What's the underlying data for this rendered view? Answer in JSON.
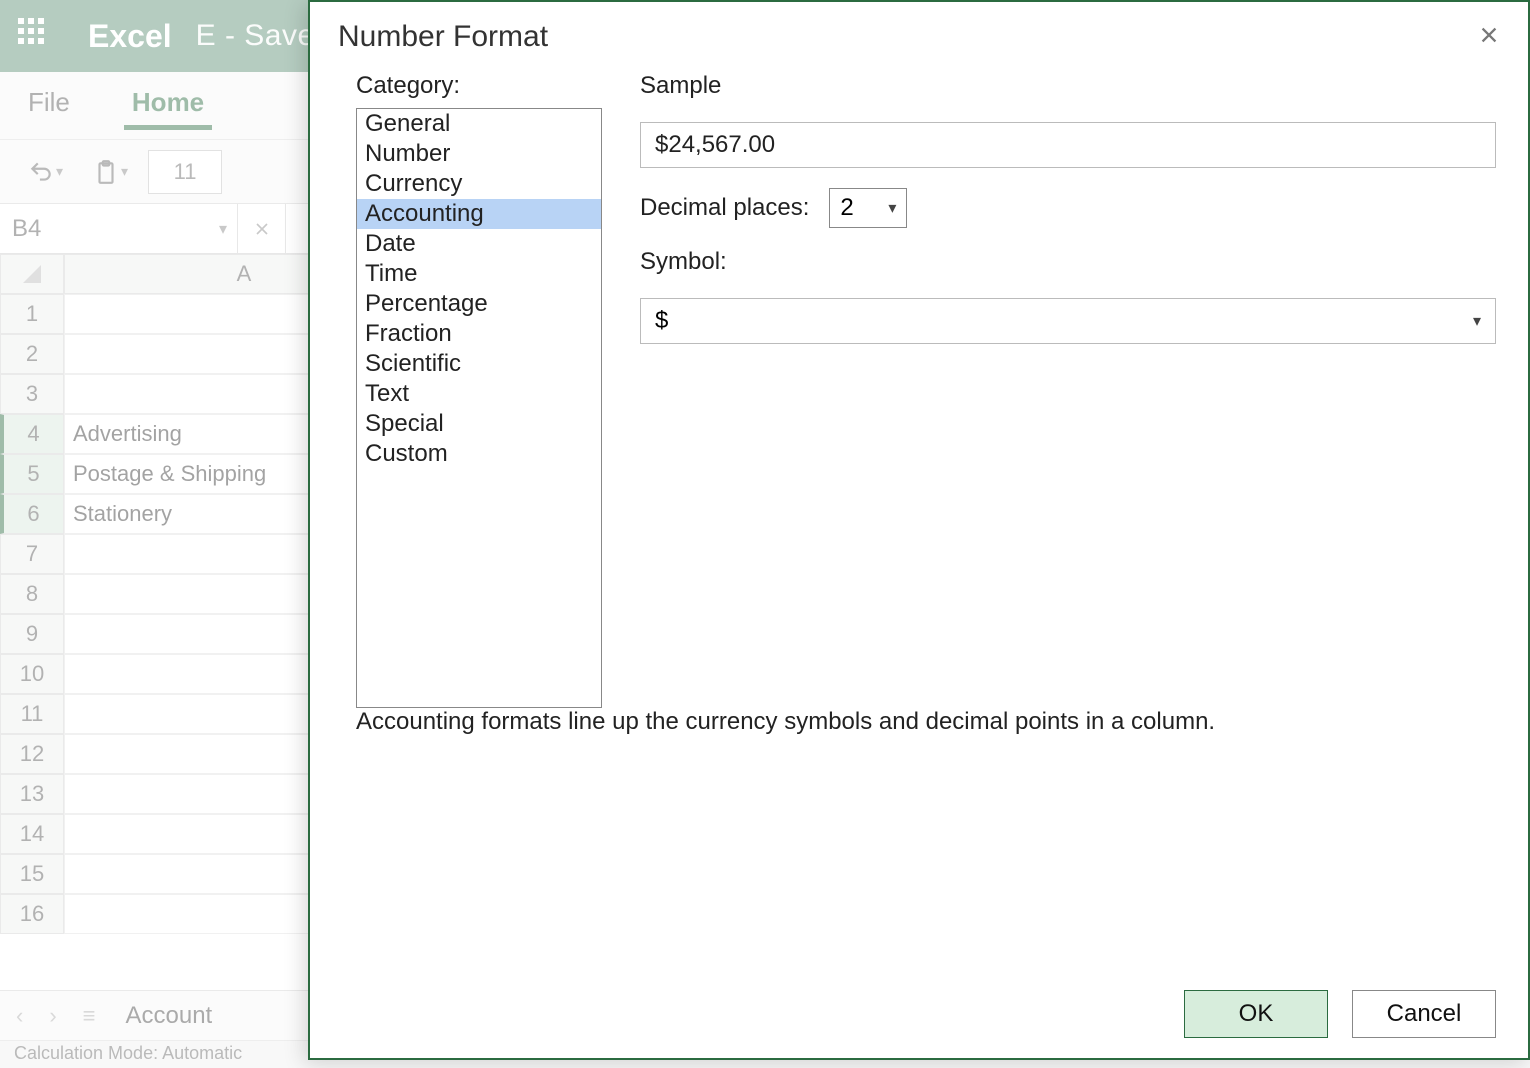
{
  "titlebar": {
    "app": "Excel",
    "doc": "E - Save"
  },
  "ribbon": {
    "tabs": [
      "File",
      "Home"
    ],
    "active_index": 1,
    "font_size": "11"
  },
  "formula_bar": {
    "name_box": "B4",
    "formula": ""
  },
  "columns": [
    "A"
  ],
  "rows": [
    {
      "n": 1,
      "A": ""
    },
    {
      "n": 2,
      "A": ""
    },
    {
      "n": 3,
      "A": ""
    },
    {
      "n": 4,
      "A": "Advertising",
      "sel": true
    },
    {
      "n": 5,
      "A": "Postage & Shipping",
      "sel": true
    },
    {
      "n": 6,
      "A": "Stationery",
      "sel": true
    },
    {
      "n": 7,
      "A": ""
    },
    {
      "n": 8,
      "A": ""
    },
    {
      "n": 9,
      "A": ""
    },
    {
      "n": 10,
      "A": ""
    },
    {
      "n": 11,
      "A": ""
    },
    {
      "n": 12,
      "A": ""
    },
    {
      "n": 13,
      "A": ""
    },
    {
      "n": 14,
      "A": ""
    },
    {
      "n": 15,
      "A": ""
    },
    {
      "n": 16,
      "A": ""
    }
  ],
  "sheet_tab": "Account",
  "statusbar": "Calculation Mode: Automatic",
  "dialog": {
    "title": "Number Format",
    "category_label": "Category:",
    "categories": [
      "General",
      "Number",
      "Currency",
      "Accounting",
      "Date",
      "Time",
      "Percentage",
      "Fraction",
      "Scientific",
      "Text",
      "Special",
      "Custom"
    ],
    "selected_category_index": 3,
    "sample_label": "Sample",
    "sample_value": "$24,567.00",
    "decimal_label": "Decimal places:",
    "decimal_value": "2",
    "symbol_label": "Symbol:",
    "symbol_value": "$",
    "description": "Accounting formats line up the currency symbols and decimal points in a column.",
    "ok": "OK",
    "cancel": "Cancel"
  }
}
